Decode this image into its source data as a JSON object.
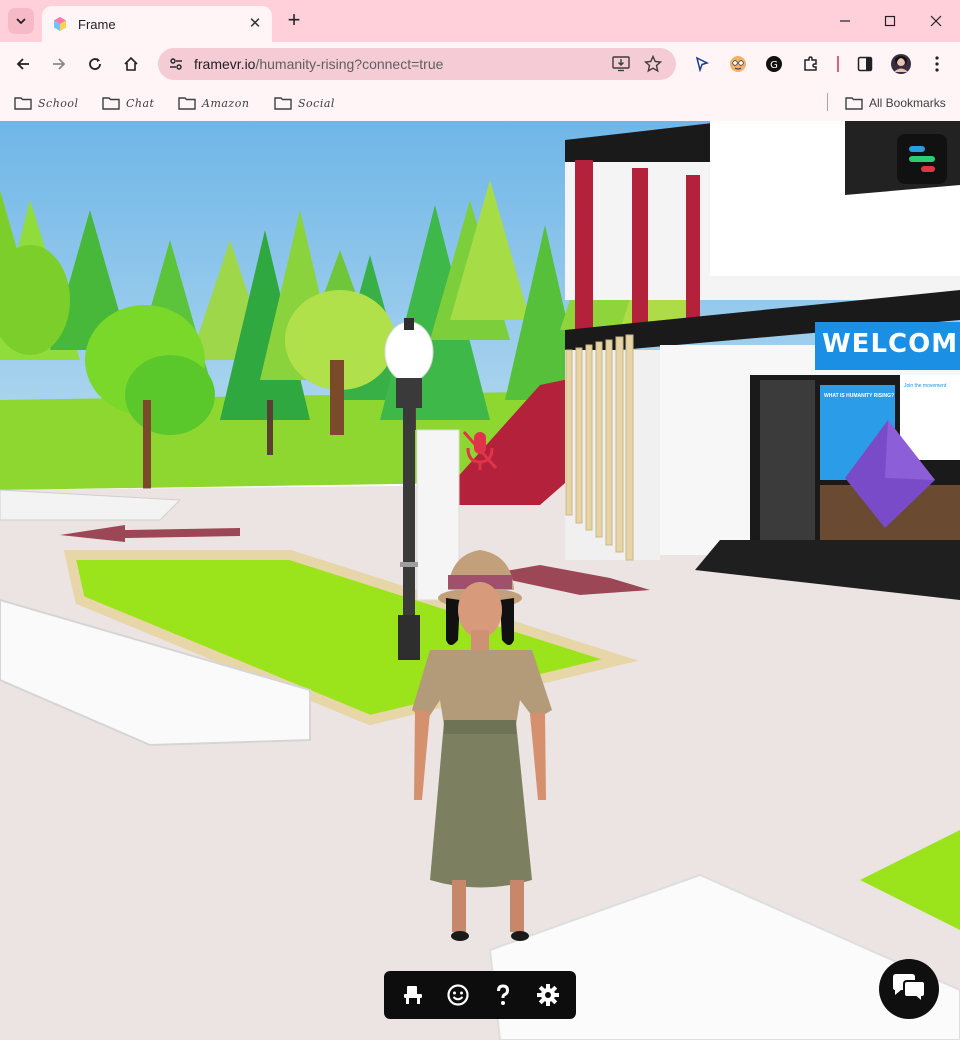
{
  "browser": {
    "tab_title": "Frame",
    "url_host": "framevr.io",
    "url_path": "/humanity-rising?connect=true",
    "bookmarks": [
      {
        "label": "School",
        "icon": "folder-icon"
      },
      {
        "label": "Chat",
        "icon": "folder-icon"
      },
      {
        "label": "Amazon",
        "icon": "folder-icon"
      },
      {
        "label": "Social",
        "icon": "folder-icon"
      }
    ],
    "all_bookmarks_label": "All Bookmarks"
  },
  "scene": {
    "welcome_sign": "WELCOM",
    "panel_heading": "WHAT IS HUMANITY RISING?",
    "right_panel_heading": "Join the movement",
    "accent_color": "#1a8fe3"
  },
  "colors": {
    "chrome_bg": "#ffd0da",
    "menu_bar_blue": "#2d9cdb",
    "menu_bar_green": "#2ecc71",
    "menu_bar_red": "#e0344a"
  }
}
